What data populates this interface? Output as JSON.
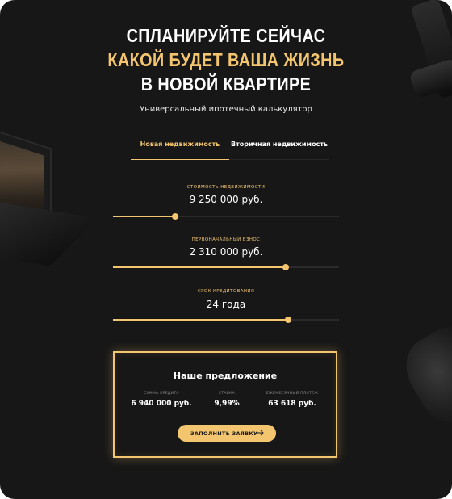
{
  "heading": {
    "line1": "СПЛАНИРУЙТЕ СЕЙЧАС",
    "line2": "КАКОЙ БУДЕТ ВАША ЖИЗНЬ",
    "line3": "В НОВОЙ КВАРТИРЕ"
  },
  "subtitle": "Универсальный ипотечный калькулятор",
  "tabs": [
    {
      "label": "Новая недвижимость",
      "active": true
    },
    {
      "label": "Вторичная недвижимость",
      "active": false
    }
  ],
  "fields": [
    {
      "label": "СТОИМОСТЬ НЕДВИЖИМОСТИ",
      "value": "9 250 000 руб.",
      "level": 0.275
    },
    {
      "label": "ПЕРВОНАЧАЛЬНЫЙ ВЗНОС",
      "value": "2 310 000 руб.",
      "level": 0.765
    },
    {
      "label": "СРОК КРЕДИТОВАНИЯ",
      "value": "24 года",
      "level": 0.775
    }
  ],
  "offer": {
    "title": "Наше предложение",
    "items": [
      {
        "label": "СУММА КРЕДИТА",
        "value": "6 940 000 руб."
      },
      {
        "label": "СТАВКА",
        "value": "9,99%"
      },
      {
        "label": "ЕЖЕМЕСЯЧНЫЙ ПЛАТЕЖ",
        "value": "63 618 руб."
      }
    ],
    "cta_label": "ЗАПОЛНИТЬ ЗАЯВКУ",
    "cta_icon": "arrow-right-icon"
  },
  "colors": {
    "background": "#171717",
    "accent": "#f4c56f",
    "text": "#ffffff"
  }
}
